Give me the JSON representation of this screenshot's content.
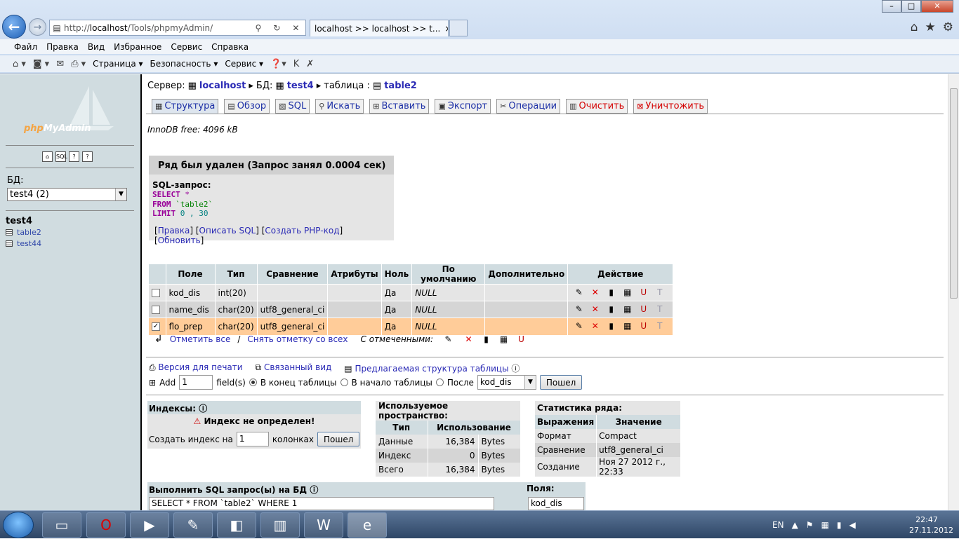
{
  "browser": {
    "url_prefix": "http://",
    "url_host": "localhost",
    "url_path": "/Tools/phpmyAdmin/",
    "tab_title": "localhost >> localhost >> t...",
    "menu": [
      "Файл",
      "Правка",
      "Вид",
      "Избранное",
      "Сервис",
      "Справка"
    ],
    "cmd": [
      "Страница ▾",
      "Безопасность ▾",
      "Сервис ▾"
    ]
  },
  "sidebar": {
    "logo": "phpMyAdmin",
    "db_label": "БД:",
    "db_selected": "test4 (2)",
    "db_name": "test4",
    "tables": [
      "table2",
      "test44"
    ]
  },
  "crumb": {
    "server_label": "Сервер:",
    "server": "localhost",
    "db_label": "БД:",
    "db": "test4",
    "table_label": "таблица :",
    "table": "table2"
  },
  "tabs": [
    "Структура",
    "Обзор",
    "SQL",
    "Искать",
    "Вставить",
    "Экспорт",
    "Операции",
    "Очистить",
    "Уничтожить"
  ],
  "innodb": "InnoDB free: 4096 kB",
  "message": {
    "header": "Ряд был удален (Запрос занял 0.0004 сек)",
    "sql_label": "SQL-запрос:",
    "sql_line1_kw": "SELECT",
    "sql_line1_rest": " *",
    "sql_line2_kw": "FROM",
    "sql_line2_rest": " `table2`",
    "sql_line3_kw": "LIMIT",
    "sql_line3_rest": " 0 , 30",
    "links": [
      "Правка",
      "Описать SQL",
      "Создать PHP-код",
      "Обновить"
    ]
  },
  "fields": {
    "headers": [
      "Поле",
      "Тип",
      "Сравнение",
      "Атрибуты",
      "Ноль",
      "По умолчанию",
      "Дополнительно",
      "Действие"
    ],
    "rows": [
      {
        "name": "kod_dis",
        "type": "int(20)",
        "collation": "",
        "attr": "",
        "null": "Да",
        "default": "NULL",
        "extra": "",
        "checked": false
      },
      {
        "name": "name_dis",
        "type": "char(20)",
        "collation": "utf8_general_ci",
        "attr": "",
        "null": "Да",
        "default": "NULL",
        "extra": "",
        "checked": false
      },
      {
        "name": "flo_prep",
        "type": "char(20)",
        "collation": "utf8_general_ci",
        "attr": "",
        "null": "Да",
        "default": "NULL",
        "extra": "",
        "checked": true
      }
    ]
  },
  "checkall": {
    "check_all": "Отметить все",
    "sep": "/",
    "uncheck_all": "Снять отметку со всех",
    "with_selected": "С отмеченными:"
  },
  "links": {
    "print": "Версия для печати",
    "relation": "Связанный вид",
    "propose": "Предлагаемая структура таблицы"
  },
  "addfield": {
    "add": "Add",
    "count": "1",
    "fields_label": "field(s)",
    "opt_end": "В конец таблицы",
    "opt_begin": "В начало таблицы",
    "opt_after": "После",
    "after_field": "kod_dis",
    "go": "Пошел"
  },
  "indexes": {
    "title": "Индексы:",
    "none": "Индекс не определен!",
    "create_label": "Создать индекс на",
    "create_count": "1",
    "cols_label": "колонках",
    "go": "Пошел"
  },
  "space": {
    "title": "Используемое пространство:",
    "headers": [
      "Тип",
      "Использование"
    ],
    "rows": [
      {
        "type": "Данные",
        "value": "16,384",
        "unit": "Bytes"
      },
      {
        "type": "Индекс",
        "value": "0",
        "unit": "Bytes"
      },
      {
        "type": "Всего",
        "value": "16,384",
        "unit": "Bytes"
      }
    ]
  },
  "stats": {
    "title": "Статистика ряда:",
    "headers": [
      "Выражения",
      "Значение"
    ],
    "rows": [
      {
        "k": "Формат",
        "v": "Compact"
      },
      {
        "k": "Сравнение",
        "v": "utf8_general_ci"
      },
      {
        "k": "Создание",
        "v": "Ноя 27 2012 г., 22:33"
      }
    ]
  },
  "sqlrun": {
    "title": "Выполнить SQL запрос(ы) на БД",
    "query": "SELECT * FROM `table2` WHERE 1",
    "fields_label": "Поля:",
    "field": "kod_dis"
  },
  "taskbar": {
    "lang": "EN",
    "time": "22:47",
    "date": "27.11.2012"
  }
}
